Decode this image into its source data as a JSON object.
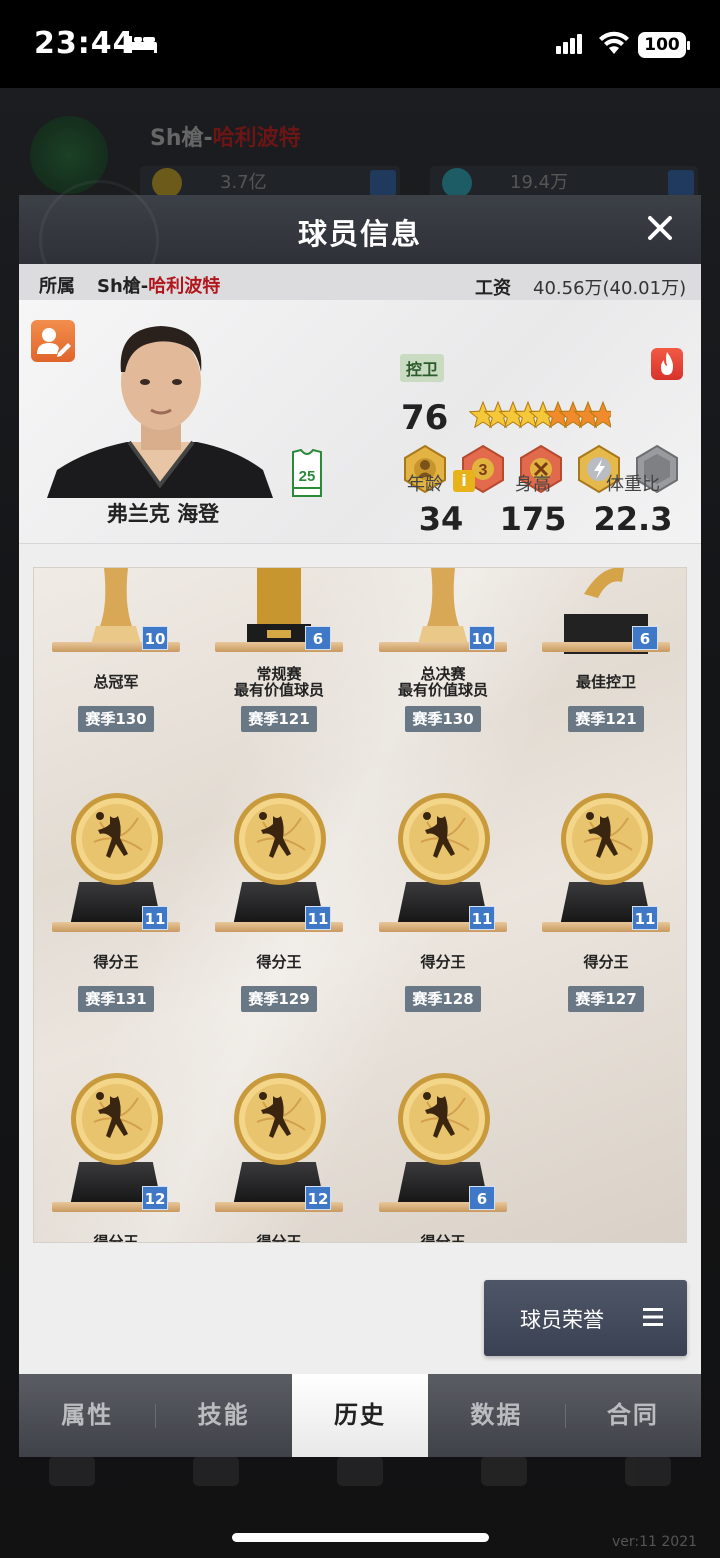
{
  "status_bar": {
    "time": "23:44",
    "battery": "100"
  },
  "background_app": {
    "team_name_prefix": "Sh槍-",
    "team_name_suffix": "哈利波特",
    "resource_1": "3.7亿",
    "resource_2": "19.4万",
    "nav": [
      "",
      "",
      "",
      "",
      ""
    ],
    "version": "ver:11 2021"
  },
  "modal": {
    "title": "球员信息",
    "team_bar": {
      "affiliation_label": "所属",
      "affiliation_prefix": "Sh槍-",
      "affiliation_team": "哈利波特",
      "salary_label": "工资",
      "salary_value": "40.56万(40.01万)"
    },
    "player": {
      "name": "弗兰克 海登",
      "jersey_number": "25",
      "position": "控卫",
      "overall": "76",
      "stars": {
        "gold": 5,
        "orange": 4
      },
      "stats": [
        {
          "label": "年龄",
          "value": "34",
          "info": "i"
        },
        {
          "label": "身高",
          "value": "175"
        },
        {
          "label": "体重比",
          "value": "22.3"
        }
      ],
      "badge_icons": [
        "gold-player-badge",
        "gold-3-badge",
        "red-x-badge",
        "silver-lightning-badge",
        "grey-locked-badge"
      ]
    },
    "honors": [
      {
        "name_line1": "总冠军",
        "name_line2": "",
        "count": "10",
        "season": "赛季130",
        "icon": "trophy-icon"
      },
      {
        "name_line1": "常规赛",
        "name_line2": "最有价值球员",
        "count": "6",
        "season": "赛季121",
        "icon": "trophy-icon"
      },
      {
        "name_line1": "总决赛",
        "name_line2": "最有价值球员",
        "count": "10",
        "season": "赛季130",
        "icon": "trophy-icon"
      },
      {
        "name_line1": "最佳控卫",
        "name_line2": "",
        "count": "6",
        "season": "赛季121",
        "icon": "trophy-icon"
      },
      {
        "name_line1": "得分王",
        "name_line2": "",
        "count": "11",
        "season": "赛季131",
        "icon": "medal-icon"
      },
      {
        "name_line1": "得分王",
        "name_line2": "",
        "count": "11",
        "season": "赛季129",
        "icon": "medal-icon"
      },
      {
        "name_line1": "得分王",
        "name_line2": "",
        "count": "11",
        "season": "赛季128",
        "icon": "medal-icon"
      },
      {
        "name_line1": "得分王",
        "name_line2": "",
        "count": "11",
        "season": "赛季127",
        "icon": "medal-icon"
      },
      {
        "name_line1": "得分王",
        "name_line2": "",
        "count": "12",
        "season": "",
        "icon": "medal-icon"
      },
      {
        "name_line1": "得分王",
        "name_line2": "",
        "count": "12",
        "season": "",
        "icon": "medal-icon"
      },
      {
        "name_line1": "得分王",
        "name_line2": "",
        "count": "6",
        "season": "",
        "icon": "medal-icon"
      }
    ],
    "honor_button": "球员荣誉",
    "tabs": [
      "属性",
      "技能",
      "历史",
      "数据",
      "合同"
    ],
    "active_tab": "历史"
  },
  "colors": {
    "accent_red": "#b0161c",
    "count_blue": "#3f78c6",
    "season_grey": "#6a7784",
    "gold": "#d9b25a"
  }
}
